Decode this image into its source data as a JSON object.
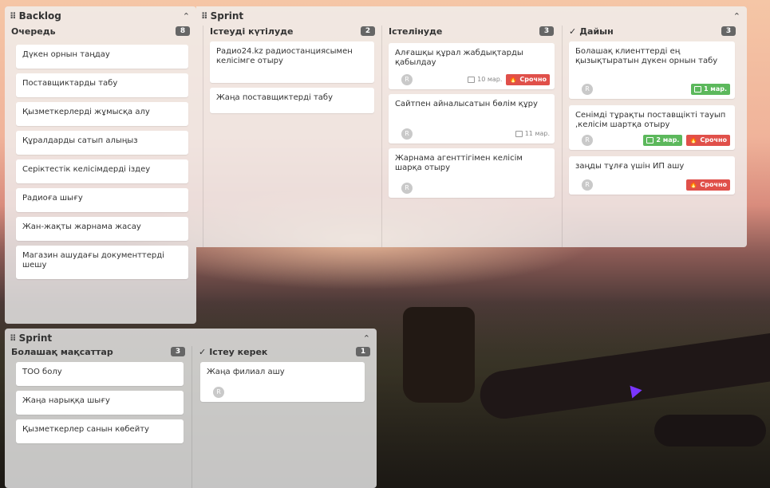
{
  "boards": [
    {
      "title": "Backlog",
      "columns": [
        {
          "title": "Очередь",
          "count": "8",
          "cards": [
            {
              "text": "Дүкен орнын таңдау"
            },
            {
              "text": "Поставщиктарды табу"
            },
            {
              "text": "Қызметкерлерді жұмысқа алу"
            },
            {
              "text": "Құралдарды сатып алыңыз"
            },
            {
              "text": "Серіктестік келісімдерді іздеу"
            },
            {
              "text": "Радиоға шығу"
            },
            {
              "text": "Жан-жақты жарнама жасау"
            },
            {
              "text": "Магазин ашудағы документтерді шешу"
            }
          ]
        }
      ]
    },
    {
      "title": "Sprint",
      "columns": [
        {
          "title": "Істеуді күтілуде",
          "count": "2",
          "cards": [
            {
              "text": "Радио24.kz радиостанциясымен келісімге отыру"
            },
            {
              "text": "Жаңа поставщиктерді табу"
            }
          ]
        },
        {
          "title": "Істелінуде",
          "count": "3",
          "cards": [
            {
              "text": "Алғашқы құрал жабдықтарды қабылдау",
              "avatar": "R",
              "date": "10 мар.",
              "urgent": "Срочно"
            },
            {
              "text": "Сайтпен айналысатын бөлім құру",
              "avatar": "R",
              "date": "11 мар."
            },
            {
              "text": "Жарнама агенттігімен келісім шарқа отыру",
              "avatar": "R"
            }
          ]
        },
        {
          "title": "Дайын",
          "count": "3",
          "cards": [
            {
              "text": "Болашақ клиенттерді ең қызықтыратын дүкен орнын табу",
              "avatar": "R",
              "date": "1 мар."
            },
            {
              "text": "Сенімді тұрақты поставщікті тауып ,келісім шартқа отыру",
              "avatar": "R",
              "date": "2 мар.",
              "urgent": "Срочно"
            },
            {
              "text": "заңды тұлға үшін ИП ашу",
              "avatar": "R",
              "urgent": "Срочно"
            }
          ]
        }
      ]
    },
    {
      "title": "Sprint",
      "columns": [
        {
          "title": "Болашақ мақсаттар",
          "count": "3",
          "cards": [
            {
              "text": "ТОО болу"
            },
            {
              "text": "Жаңа нарыққа шығу"
            },
            {
              "text": "Қызметкерлер санын көбейту"
            }
          ]
        },
        {
          "title": "Істеу керек",
          "count": "1",
          "cards": [
            {
              "text": "Жаңа филиал ашу",
              "avatar": "R"
            }
          ]
        }
      ]
    }
  ],
  "icons": {
    "drag": "drag-handle-icon",
    "collapse": "chevron-up-icon",
    "check": "check-icon",
    "calendar": "calendar-icon",
    "fire": "fire-icon"
  },
  "colors": {
    "date_green": "#5cb85c",
    "urgent_red": "#e0504a",
    "count_badge": "#666666"
  }
}
